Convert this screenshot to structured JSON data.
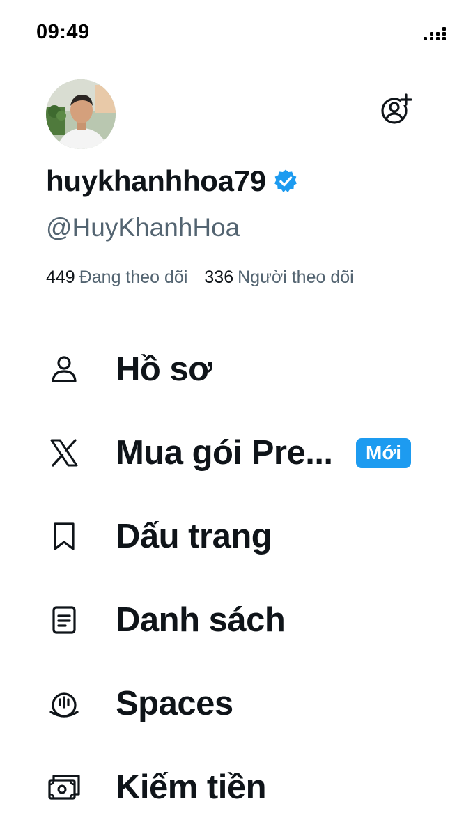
{
  "status_bar": {
    "time": "09:49"
  },
  "profile": {
    "display_name": "huykhanhhoa79",
    "verified": true,
    "handle": "@HuyKhanhHoa",
    "following_count": "449",
    "following_label": "Đang theo dõi",
    "followers_count": "336",
    "followers_label": "Người theo dõi"
  },
  "menu": {
    "items": [
      {
        "label": "Hồ sơ",
        "icon": "person-icon"
      },
      {
        "label": "Mua gói Pre...",
        "icon": "x-logo-icon",
        "badge": "Mới"
      },
      {
        "label": "Dấu trang",
        "icon": "bookmark-icon"
      },
      {
        "label": "Danh sách",
        "icon": "list-icon"
      },
      {
        "label": "Spaces",
        "icon": "spaces-icon"
      },
      {
        "label": "Kiếm tiền",
        "icon": "money-icon"
      }
    ]
  },
  "colors": {
    "accent": "#1d9bf0",
    "text_primary": "#0f1419",
    "text_secondary": "#536471",
    "background": "#ffffff"
  }
}
